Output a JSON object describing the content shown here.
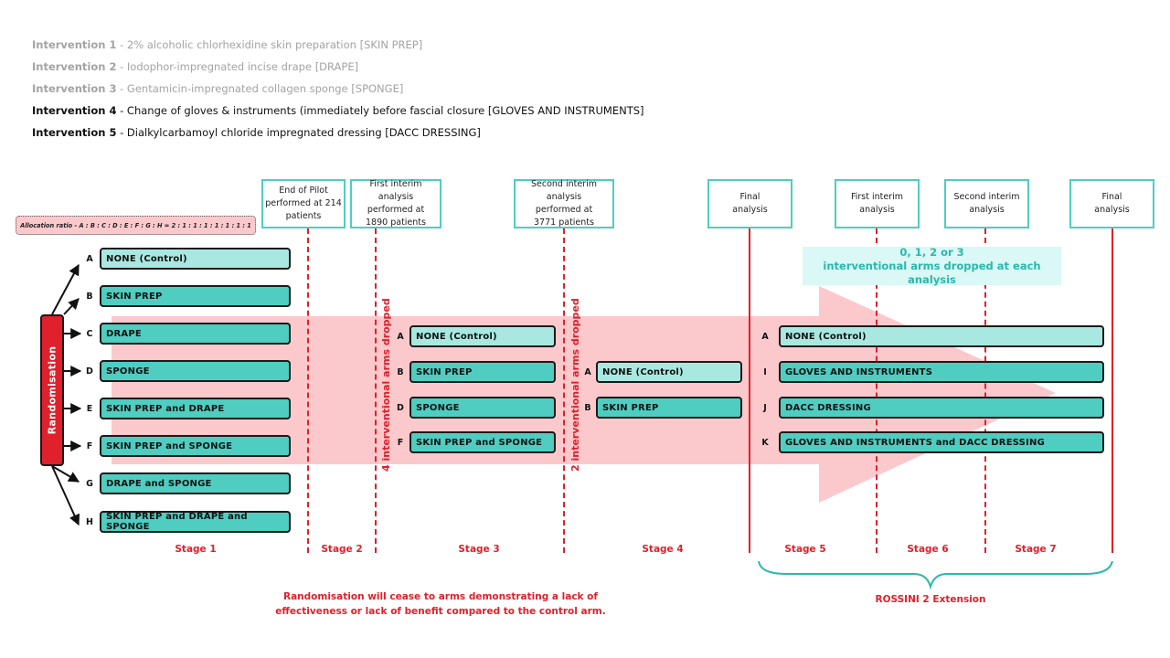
{
  "interventions": [
    {
      "label": "Intervention 1",
      "desc": " - 2% alcoholic chlorhexidine skin preparation [SKIN PREP]",
      "state": "greyed"
    },
    {
      "label": "Intervention 2",
      "desc": " - Iodophor-impregnated incise drape [DRAPE]",
      "state": "greyed"
    },
    {
      "label": "Intervention 3",
      "desc": " - Gentamicin-impregnated collagen sponge [SPONGE]",
      "state": "greyed"
    },
    {
      "label": "Intervention 4",
      "desc": " - Change of gloves & instruments (immediately before fascial closure [GLOVES AND INSTRUMENTS]",
      "state": "active"
    },
    {
      "label": "Intervention 5",
      "desc": " - Dialkylcarbamoyl chloride impregnated dressing [DACC DRESSING]",
      "state": "active"
    }
  ],
  "allocation_ratio": "Allocation ratio - A : B : C : D : E : F : G : H = 2 : 1 : 1 : 1 : 1 : 1 : 1 : 1",
  "randomisation_label": "Randomisation",
  "milestones": [
    {
      "l1": "End of Pilot",
      "l2": "performed at 214",
      "l3": "patients"
    },
    {
      "l1": "First interim analysis",
      "l2": "performed at",
      "l3": "1890 patients"
    },
    {
      "l1": "Second interim analysis",
      "l2": "performed at",
      "l3": "3771 patients"
    },
    {
      "l1": "Final",
      "l2": "analysis"
    },
    {
      "l1": "First interim",
      "l2": "analysis"
    },
    {
      "l1": "Second interim",
      "l2": "analysis"
    },
    {
      "l1": "Final",
      "l2": "analysis"
    }
  ],
  "stage1_arms": [
    {
      "letter": "A",
      "label": "NONE (Control)",
      "type": "control"
    },
    {
      "letter": "B",
      "label": "SKIN PREP",
      "type": "interv"
    },
    {
      "letter": "C",
      "label": "DRAPE",
      "type": "interv"
    },
    {
      "letter": "D",
      "label": "SPONGE",
      "type": "interv"
    },
    {
      "letter": "E",
      "label": "SKIN PREP and DRAPE",
      "type": "interv"
    },
    {
      "letter": "F",
      "label": "SKIN PREP and SPONGE",
      "type": "interv"
    },
    {
      "letter": "G",
      "label": "DRAPE and SPONGE",
      "type": "interv"
    },
    {
      "letter": "H",
      "label": "SKIN PREP and DRAPE and SPONGE",
      "type": "interv"
    }
  ],
  "stage3_arms": [
    {
      "letter": "A",
      "label": "NONE (Control)",
      "type": "control"
    },
    {
      "letter": "B",
      "label": "SKIN PREP",
      "type": "interv"
    },
    {
      "letter": "D",
      "label": "SPONGE",
      "type": "interv"
    },
    {
      "letter": "F",
      "label": "SKIN PREP and SPONGE",
      "type": "interv"
    }
  ],
  "stage4_arms": [
    {
      "letter": "A",
      "label": "NONE (Control)",
      "type": "control"
    },
    {
      "letter": "B",
      "label": "SKIN PREP",
      "type": "interv"
    }
  ],
  "extension_arms": [
    {
      "letter": "A",
      "label": "NONE (Control)",
      "type": "control"
    },
    {
      "letter": "I",
      "label": "GLOVES AND INSTRUMENTS",
      "type": "interv"
    },
    {
      "letter": "J",
      "label": "DACC DRESSING",
      "type": "interv"
    },
    {
      "letter": "K",
      "label": "GLOVES AND INSTRUMENTS and DACC DRESSING",
      "type": "interv"
    }
  ],
  "drop_labels": {
    "first": "4 interventional arms dropped",
    "second": "2 interventional arms dropped",
    "extension_l1": "0, 1, 2 or 3",
    "extension_l2": "interventional arms dropped at each analysis"
  },
  "stages": [
    "Stage 1",
    "Stage 2",
    "Stage 3",
    "Stage 4",
    "Stage 5",
    "Stage 6",
    "Stage 7"
  ],
  "footer_note_l1": "Randomisation will cease to arms demonstrating a lack of",
  "footer_note_l2": "effectiveness or lack of benefit compared to the control arm.",
  "extension_label": "ROSSINI 2 Extension",
  "colors": {
    "accent_red": "#e0202a",
    "teal": "#4ecdc0",
    "teal_light": "#a9e8e1",
    "pink_band": "#fbc9cc",
    "callout_bg": "#d9f8f6",
    "callout_text": "#2bb8ab"
  }
}
